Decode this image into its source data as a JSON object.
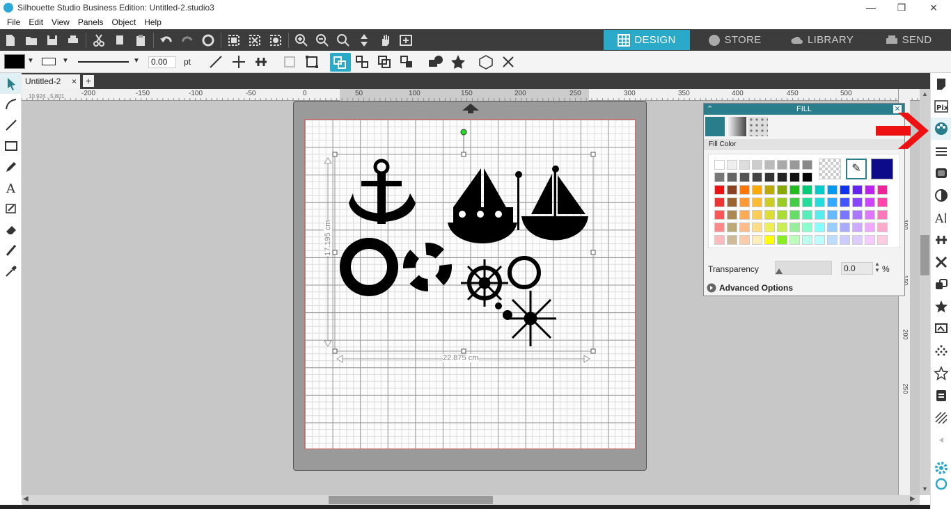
{
  "window": {
    "title": "Silhouette Studio Business Edition: Untitled-2.studio3"
  },
  "menu": [
    "File",
    "Edit",
    "View",
    "Panels",
    "Object",
    "Help"
  ],
  "nav_tabs": [
    {
      "label": "DESIGN",
      "active": true,
      "icon": "grid-icon"
    },
    {
      "label": "STORE",
      "active": false,
      "icon": "store-icon"
    },
    {
      "label": "LIBRARY",
      "active": false,
      "icon": "cloud-icon"
    },
    {
      "label": "SEND",
      "active": false,
      "icon": "printer-icon"
    }
  ],
  "quick_toolbar": {
    "line_width_value": "0.00",
    "line_width_unit": "pt",
    "fill_color": "#000000"
  },
  "document_tab": {
    "label": "Untitled-2",
    "close": "×",
    "add": "+"
  },
  "cursor_readout": "10.924 , 5.801",
  "ruler": {
    "h_ticks": [
      "-200",
      "-150",
      "-100",
      "-50",
      "0",
      "50",
      "100",
      "150",
      "200",
      "250",
      "300",
      "350",
      "400",
      "450",
      "500"
    ],
    "v_ticks": [
      "100",
      "150",
      "200",
      "250"
    ]
  },
  "selection": {
    "width_label": "22.875 cm",
    "height_label": "17.195 cm"
  },
  "fill_panel": {
    "title": "FILL",
    "section_label": "Fill Color",
    "transparency_label": "Transparency",
    "transparency_value": "0.0",
    "transparency_unit": "%",
    "advanced_label": "Advanced Options",
    "fill_modes": [
      "solid-color",
      "gradient",
      "pattern"
    ],
    "grays": [
      "#ffffff",
      "#eeeeee",
      "#dddddd",
      "#cccccc",
      "#bbbbbb",
      "#aaaaaa",
      "#999999",
      "#888888",
      "#777777",
      "#666666",
      "#555555",
      "#444444",
      "#333333",
      "#222222",
      "#111111",
      "#000000"
    ],
    "selected_color": "#0c0c8a",
    "palette": [
      [
        "#ee1111",
        "#884422",
        "#ff7700",
        "#ffaa00",
        "#bbaa00",
        "#88aa00",
        "#22bb22",
        "#00cc77",
        "#00cccc",
        "#0099ee",
        "#1133ee",
        "#6622ee",
        "#bb22ee",
        "#ee2299"
      ],
      [
        "#ee3333",
        "#996633",
        "#ff9933",
        "#ffbb33",
        "#cccc22",
        "#99cc22",
        "#44cc44",
        "#22dd99",
        "#22dddd",
        "#33aaff",
        "#4455ff",
        "#8844ff",
        "#cc44ff",
        "#ff44aa"
      ],
      [
        "#ff5555",
        "#aa8855",
        "#ffaa55",
        "#ffcc55",
        "#dddd33",
        "#aadd33",
        "#66dd66",
        "#55eebb",
        "#55eeee",
        "#66bbff",
        "#7777ff",
        "#aa77ff",
        "#dd77ff",
        "#ff77bb"
      ],
      [
        "#ff8888",
        "#bbaa77",
        "#ffbb88",
        "#ffdd88",
        "#eeee55",
        "#ccee55",
        "#99ee99",
        "#88ffcc",
        "#88ffff",
        "#99ccff",
        "#aaaaff",
        "#ccaaff",
        "#eeaaff",
        "#ffaacc"
      ],
      [
        "#ffbbbb",
        "#ccbb99",
        "#ffccaa",
        "#ffeebb",
        "#ffff00",
        "#88ee22",
        "#bbffbb",
        "#bbffee",
        "#bbffff",
        "#bbddff",
        "#ccccff",
        "#ddccff",
        "#f4ccff",
        "#ffcce0"
      ]
    ]
  },
  "colors": {
    "accent": "#2aa9c9",
    "dark_toolbar": "#3c3c3c",
    "panel_header": "#2a7d8a",
    "red_arrow": "#ee1111"
  }
}
